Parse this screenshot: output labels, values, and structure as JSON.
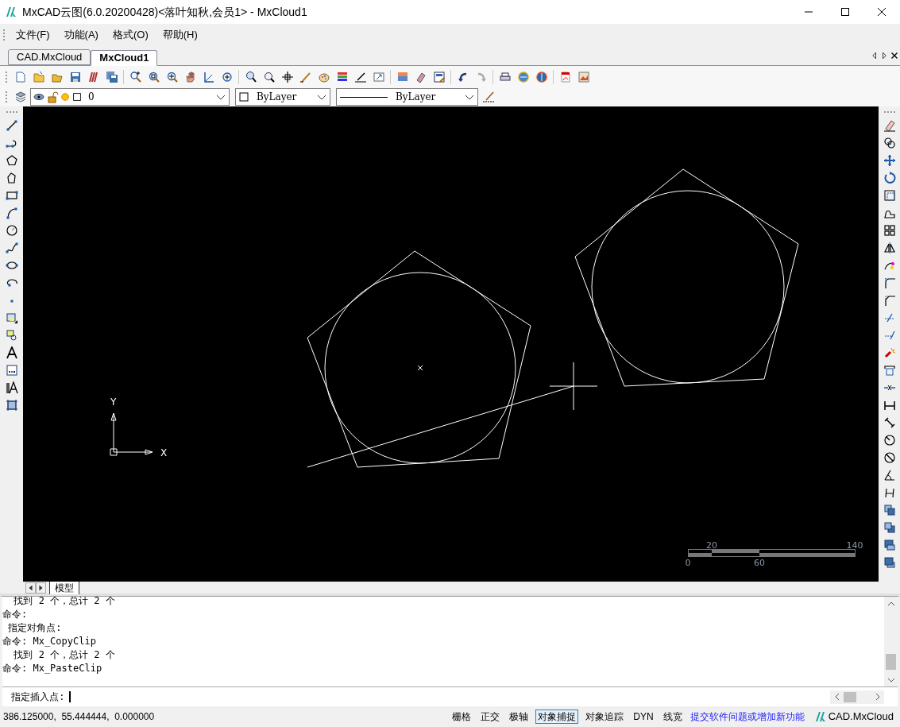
{
  "window": {
    "title": "MxCAD云图(6.0.20200428)<落叶知秋,会员1> - MxCloud1"
  },
  "menu": [
    "文件(F)",
    "功能(A)",
    "格式(O)",
    "帮助(H)"
  ],
  "doc_tabs": [
    {
      "label": "CAD.MxCloud",
      "selected": false
    },
    {
      "label": "MxCloud1",
      "selected": true
    }
  ],
  "properties_bar": {
    "layer": "0",
    "color_setting": "ByLayer",
    "linetype": "ByLayer"
  },
  "drawing": {
    "axis_labels": {
      "y": "Y",
      "x": "X"
    },
    "scale_bar": {
      "top_labels": [
        "20",
        "140"
      ],
      "bottom_labels": [
        "0",
        "60"
      ]
    }
  },
  "layout_tabs": [
    {
      "label": "模型",
      "selected": true
    }
  ],
  "command_history": [
    "  找到 2 个，总计 2 个",
    "命令:",
    " 指定对角点:",
    "命令: Mx_CopyClip",
    "  找到 2 个，总计 2 个",
    "命令: Mx_PasteClip"
  ],
  "command_prompt": " 指定插入点:",
  "status_bar": {
    "coordinates": "386.125000,  55.444444,  0.000000",
    "toggles": [
      {
        "label": "栅格",
        "on": false
      },
      {
        "label": "正交",
        "on": false
      },
      {
        "label": "极轴",
        "on": false
      },
      {
        "label": "对象捕捉",
        "on": true
      },
      {
        "label": "对象追踪",
        "on": false
      },
      {
        "label": "DYN",
        "on": false
      },
      {
        "label": "线宽",
        "on": false
      }
    ],
    "feedback_link": "提交软件问题或增加新功能",
    "brand": "CAD.MxCloud"
  }
}
